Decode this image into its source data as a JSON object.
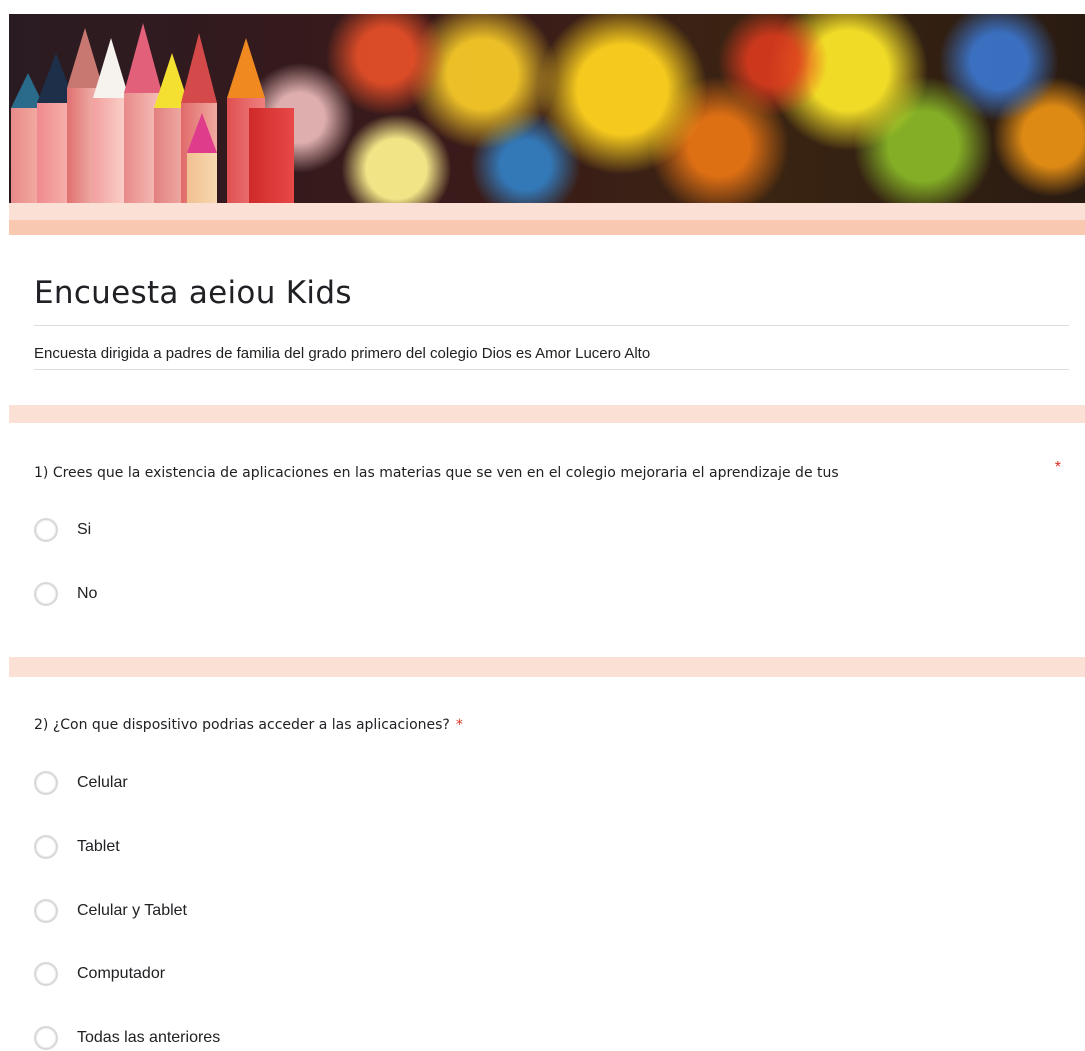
{
  "header": {
    "banner_icon": "colored-pencils-bokeh-banner",
    "title": "Encuesta aeiou Kids",
    "description": "Encuesta dirigida a padres de familia del grado primero del colegio Dios es Amor Lucero Alto"
  },
  "questions": [
    {
      "text": "1) Crees que la existencia de aplicaciones en las materias que se ven en el colegio mejoraria el aprendizaje de tus",
      "required_mark": "*",
      "options": [
        "Si",
        "No"
      ]
    },
    {
      "text": "2) ¿Con que dispositivo podrias acceder a las aplicaciones?",
      "required_mark": "*",
      "options": [
        "Celular",
        "Tablet",
        "Celular y Tablet",
        "Computador",
        "Todas las anteriores"
      ]
    }
  ],
  "colors": {
    "accent_band": "#fbe0d6",
    "accent_band_dark": "#f8c9b0",
    "required": "#d93025"
  }
}
